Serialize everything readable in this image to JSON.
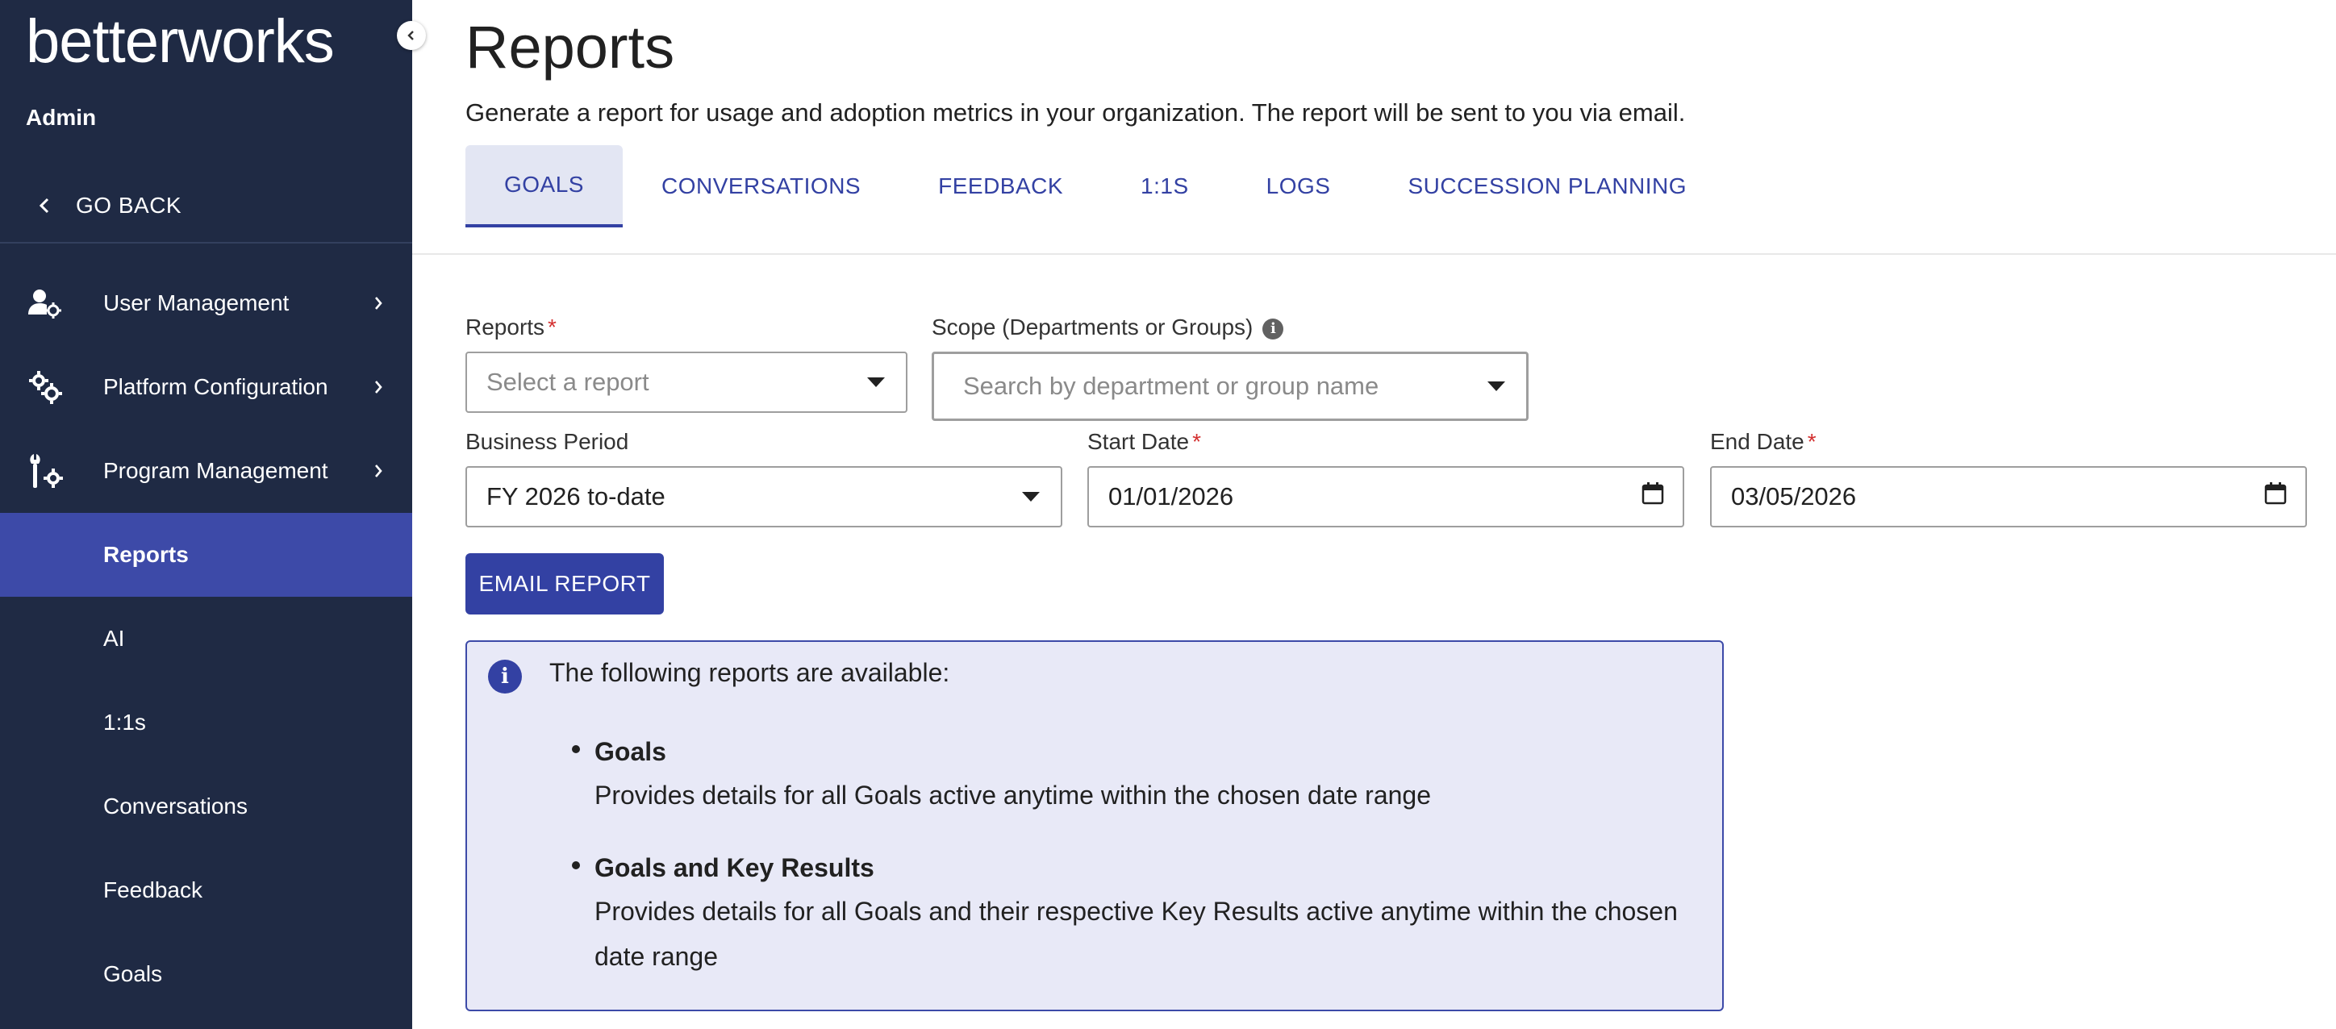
{
  "sidebar": {
    "logo": "betterworks",
    "section": "Admin",
    "go_back": "GO BACK",
    "items": [
      {
        "label": "User Management"
      },
      {
        "label": "Platform Configuration"
      },
      {
        "label": "Program Management"
      },
      {
        "label": "Reports"
      },
      {
        "label": "AI"
      },
      {
        "label": "1:1s"
      },
      {
        "label": "Conversations"
      },
      {
        "label": "Feedback"
      },
      {
        "label": "Goals"
      }
    ]
  },
  "header": {
    "title": "Reports",
    "subtitle": "Generate a report for usage and adoption metrics in your organization. The report will be sent to you via email."
  },
  "tabs": [
    "GOALS",
    "CONVERSATIONS",
    "FEEDBACK",
    "1:1S",
    "LOGS",
    "SUCCESSION PLANNING"
  ],
  "form": {
    "reports_label": "Reports",
    "reports_placeholder": "Select a report",
    "scope_label": "Scope (Departments or Groups)",
    "scope_placeholder": "Search by department or group name",
    "period_label": "Business Period",
    "period_value": "FY 2026 to-date",
    "start_label": "Start Date",
    "start_value": "01/01/2026",
    "end_label": "End Date",
    "end_value": "03/05/2026",
    "required_mark": "*",
    "email_button": "EMAIL REPORT"
  },
  "info": {
    "intro": "The following reports are available:",
    "reports": [
      {
        "title": "Goals",
        "desc": "Provides details for all Goals active anytime within the chosen date range"
      },
      {
        "title": "Goals and Key Results",
        "desc": "Provides details for all Goals and their respective Key Results active anytime within the chosen date range"
      }
    ]
  }
}
